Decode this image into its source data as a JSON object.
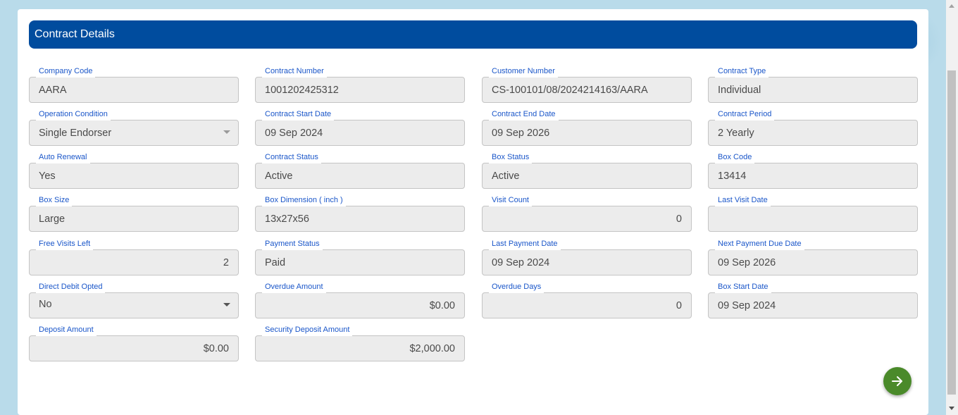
{
  "header": {
    "title": "Contract Details"
  },
  "fields": {
    "company_code": {
      "label": "Company Code",
      "value": "AARA"
    },
    "contract_number": {
      "label": "Contract Number",
      "value": "1001202425312"
    },
    "customer_number": {
      "label": "Customer Number",
      "value": "CS-100101/08/2024214163/AARA"
    },
    "contract_type": {
      "label": "Contract Type",
      "value": "Individual"
    },
    "operation_condition": {
      "label": "Operation Condition",
      "value": "Single Endorser"
    },
    "contract_start_date": {
      "label": "Contract Start Date",
      "value": "09 Sep 2024"
    },
    "contract_end_date": {
      "label": "Contract End Date",
      "value": "09 Sep 2026"
    },
    "contract_period": {
      "label": "Contract Period",
      "value": "2 Yearly"
    },
    "auto_renewal": {
      "label": "Auto Renewal",
      "value": "Yes"
    },
    "contract_status": {
      "label": "Contract Status",
      "value": "Active"
    },
    "box_status": {
      "label": "Box Status",
      "value": "Active"
    },
    "box_code": {
      "label": "Box Code",
      "value": "13414"
    },
    "box_size": {
      "label": "Box Size",
      "value": "Large"
    },
    "box_dimension": {
      "label": "Box Dimension ( inch )",
      "value": "13x27x56"
    },
    "visit_count": {
      "label": "Visit Count",
      "value": "0"
    },
    "last_visit_date": {
      "label": "Last Visit Date",
      "value": ""
    },
    "free_visits_left": {
      "label": "Free Visits Left",
      "value": "2"
    },
    "payment_status": {
      "label": "Payment Status",
      "value": "Paid"
    },
    "last_payment_date": {
      "label": "Last Payment Date",
      "value": "09 Sep 2024"
    },
    "next_payment_due_date": {
      "label": "Next Payment Due Date",
      "value": "09 Sep 2026"
    },
    "direct_debit_opted": {
      "label": "Direct Debit Opted",
      "value": "No"
    },
    "overdue_amount": {
      "label": "Overdue Amount",
      "value": "$0.00"
    },
    "overdue_days": {
      "label": "Overdue Days",
      "value": "0"
    },
    "box_start_date": {
      "label": "Box Start Date",
      "value": "09 Sep 2024"
    },
    "deposit_amount": {
      "label": "Deposit Amount",
      "value": "$0.00"
    },
    "security_deposit_amount": {
      "label": "Security Deposit Amount",
      "value": "$2,000.00"
    }
  },
  "actions": {
    "next_icon": "arrow-right-icon"
  },
  "colors": {
    "header_bg": "#004c9e",
    "label": "#1a56c9",
    "fab_bg": "#4a8a2a",
    "field_bg": "#ececec"
  }
}
